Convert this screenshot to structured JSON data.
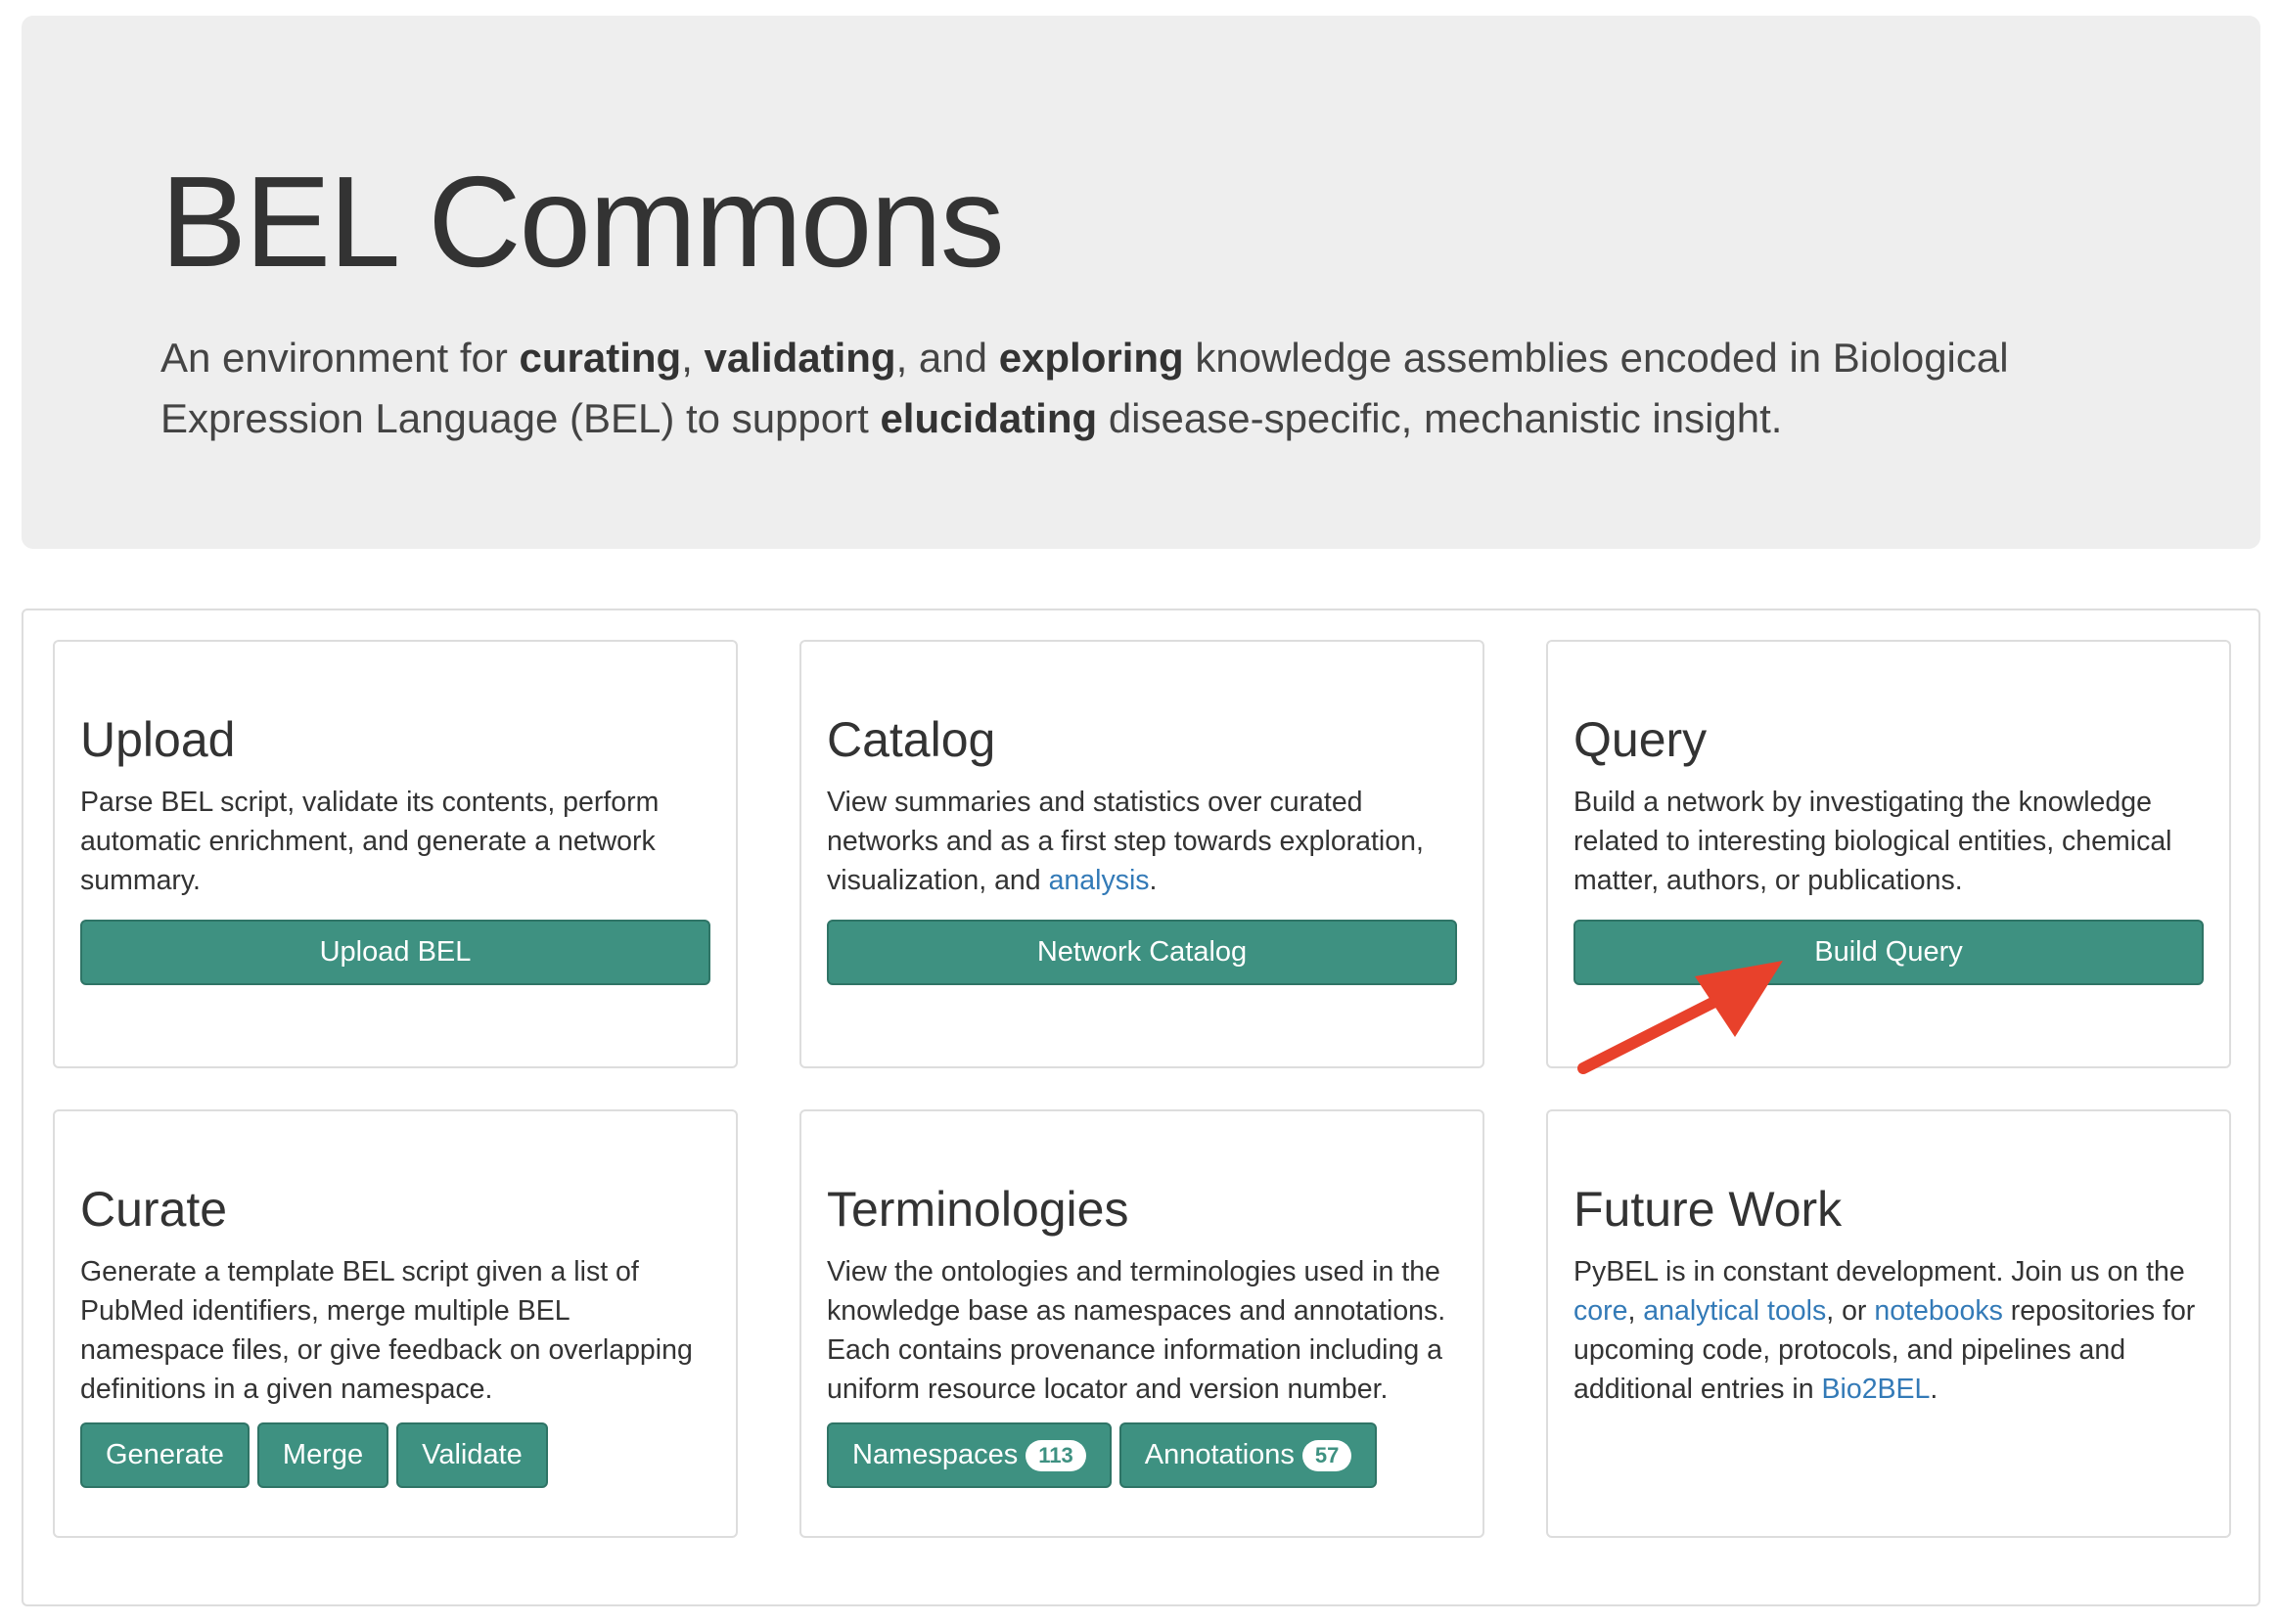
{
  "hero": {
    "title": "BEL Commons",
    "lead_1": "An environment for ",
    "lead_b1": "curating",
    "lead_2": ", ",
    "lead_b2": "validating",
    "lead_3": ", and ",
    "lead_b3": "exploring",
    "lead_4": " knowledge assemblies encoded in Biological Expression Language (BEL) to support ",
    "lead_b4": "elucidating",
    "lead_5": " disease-specific, mechanistic insight."
  },
  "upload": {
    "title": "Upload",
    "desc": "Parse BEL script, validate its contents, perform automatic enrichment, and generate a network summary.",
    "button": "Upload BEL"
  },
  "catalog": {
    "title": "Catalog",
    "desc_1": "View summaries and statistics over curated networks and as a first step towards exploration, visualization, and ",
    "desc_link": "analysis",
    "desc_2": ".",
    "button": "Network Catalog"
  },
  "query": {
    "title": "Query",
    "desc": "Build a network by investigating the knowledge related to interesting biological entities, chemical matter, authors, or publications.",
    "button": "Build Query"
  },
  "curate": {
    "title": "Curate",
    "desc": "Generate a template BEL script given a list of PubMed identifiers, merge multiple BEL namespace files, or give feedback on overlapping definitions in a given namespace.",
    "buttons": {
      "generate": "Generate",
      "merge": "Merge",
      "validate": "Validate"
    }
  },
  "terminologies": {
    "title": "Terminologies",
    "desc": "View the ontologies and terminologies used in the knowledge base as namespaces and annotations. Each contains provenance information including a uniform resource locator and version number.",
    "namespaces_label": "Namespaces",
    "namespaces_count": "113",
    "annotations_label": "Annotations",
    "annotations_count": "57"
  },
  "future": {
    "title": "Future Work",
    "desc_1": "PyBEL is in constant development. Join us on the ",
    "link_core": "core",
    "sep_1": ", ",
    "link_tools": "analytical tools",
    "sep_2": ", or ",
    "link_notebooks": "notebooks",
    "desc_2": " repositories for upcoming code, protocols, and pipelines and additional entries in ",
    "link_bio2bel": "Bio2BEL",
    "desc_3": "."
  },
  "colors": {
    "button": "#3e9181",
    "link": "#337ab7",
    "jumbotron_bg": "#eeeeee",
    "arrow": "#e8412b"
  }
}
